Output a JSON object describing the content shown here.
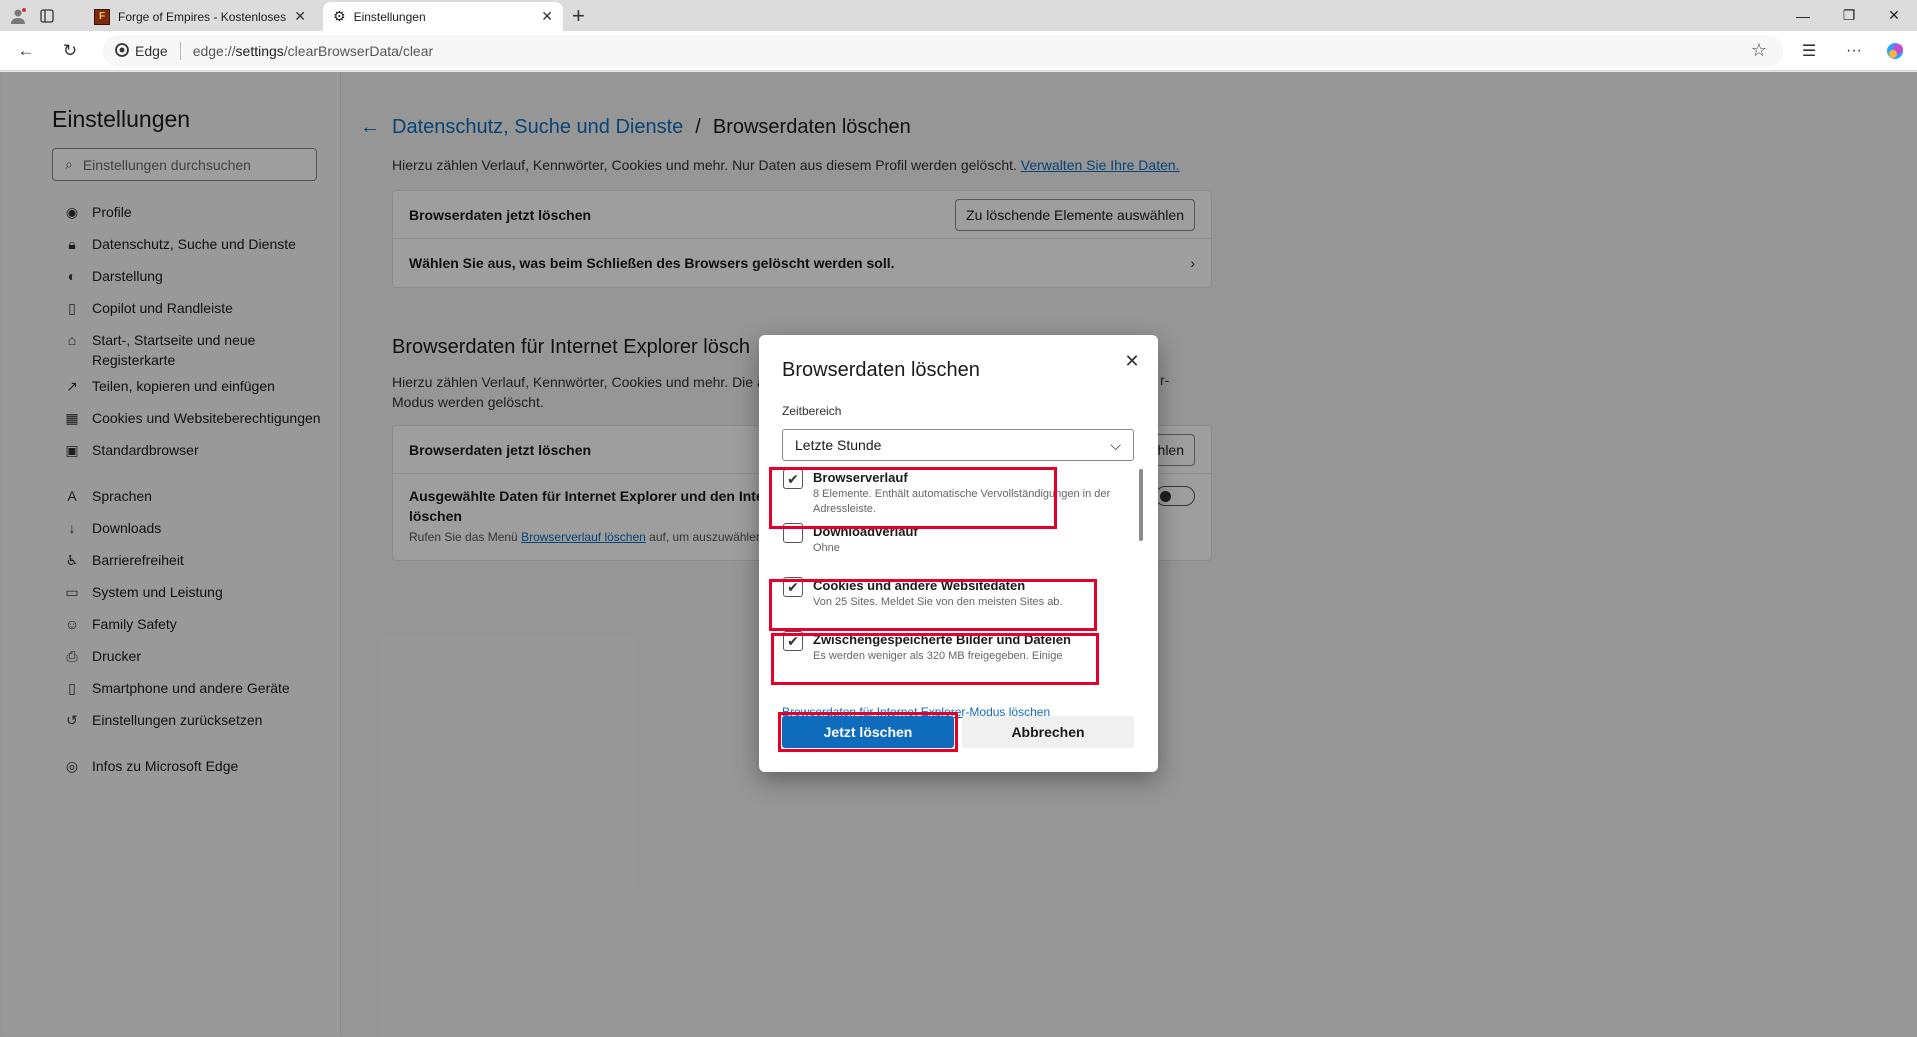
{
  "tabs": [
    {
      "title": "Forge of Empires - Kostenloses O",
      "active": false
    },
    {
      "title": "Einstellungen",
      "active": true
    }
  ],
  "address": {
    "chip": "Edge",
    "url_prefix": "edge://",
    "url_main": "settings",
    "url_suffix": "/clearBrowserData/clear"
  },
  "sidebar": {
    "title": "Einstellungen",
    "search_placeholder": "Einstellungen durchsuchen",
    "items": [
      {
        "label": "Profile",
        "icon": "profile-icon"
      },
      {
        "label": "Datenschutz, Suche und Dienste",
        "icon": "lock-icon"
      },
      {
        "label": "Darstellung",
        "icon": "appearance-icon"
      },
      {
        "label": "Copilot und Randleiste",
        "icon": "sidebar-icon"
      },
      {
        "label": "Start-, Startseite und neue Registerkarte",
        "icon": "home-icon"
      },
      {
        "label": "Teilen, kopieren und einfügen",
        "icon": "share-icon"
      },
      {
        "label": "Cookies und Websiteberechtigungen",
        "icon": "cookies-icon"
      },
      {
        "label": "Standardbrowser",
        "icon": "browser-icon"
      },
      {
        "label": "Sprachen",
        "icon": "language-icon"
      },
      {
        "label": "Downloads",
        "icon": "download-icon"
      },
      {
        "label": "Barrierefreiheit",
        "icon": "accessibility-icon"
      },
      {
        "label": "System und Leistung",
        "icon": "system-icon"
      },
      {
        "label": "Family Safety",
        "icon": "family-icon"
      },
      {
        "label": "Drucker",
        "icon": "printer-icon"
      },
      {
        "label": "Smartphone und andere Geräte",
        "icon": "phone-icon"
      },
      {
        "label": "Einstellungen zurücksetzen",
        "icon": "reset-icon"
      },
      {
        "label": "Infos zu Microsoft Edge",
        "icon": "edge-icon"
      }
    ]
  },
  "main": {
    "breadcrumb_link": "Datenschutz, Suche und Dienste",
    "breadcrumb_sep": "/",
    "breadcrumb_current": "Browserdaten löschen",
    "intro": "Hierzu zählen Verlauf, Kennwörter, Cookies und mehr. Nur Daten aus diesem Profil werden gelöscht.",
    "intro_link": "Verwalten Sie Ihre Daten.",
    "card1_row1": "Browserdaten jetzt löschen",
    "card1_button": "Zu löschende Elemente auswählen",
    "card1_row2": "Wählen Sie aus, was beim Schließen des Browsers gelöscht werden soll.",
    "ie_title": "Browserdaten für Internet Explorer lösch",
    "ie_para": "Hierzu zählen Verlauf, Kennwörter, Cookies und mehr. Die a",
    "ie_para_line2": "Modus werden gelöscht.",
    "ie_para_right": "r-",
    "ie_row1": "Browserdaten jetzt löschen",
    "ie_row1_btn": "hlen",
    "ie_row2_line1": "Ausgewählte Daten für Internet Explorer und den Intern",
    "ie_row2_line2": "löschen",
    "ie_row2_desc_pre": "Rufen Sie das Menü",
    "ie_row2_desc_link": "Browserverlauf löschen",
    "ie_row2_desc_post": "auf, um auszuwählen,"
  },
  "dialog": {
    "title": "Browserdaten löschen",
    "range_label": "Zeitbereich",
    "range_value": "Letzte Stunde",
    "options": [
      {
        "title": "Browserverlauf",
        "desc": "8 Elemente. Enthält automatische Vervollständigungen in der Adressleiste.",
        "checked": true
      },
      {
        "title": "Downloadverlauf",
        "desc": "Ohne",
        "checked": false
      },
      {
        "title": "Cookies und andere Websitedaten",
        "desc": "Von 25 Sites. Meldet Sie von den meisten Sites ab.",
        "checked": true
      },
      {
        "title": "Zwischengespeicherte Bilder und Dateien",
        "desc": "Es werden weniger als 320 MB freigegeben. Einige",
        "checked": true
      }
    ],
    "ie_link": "Browserdaten für Internet Explorer-Modus löschen",
    "primary": "Jetzt löschen",
    "secondary": "Abbrechen"
  },
  "colors": {
    "accent": "#0f6cbd",
    "highlight": "#e4002b"
  }
}
